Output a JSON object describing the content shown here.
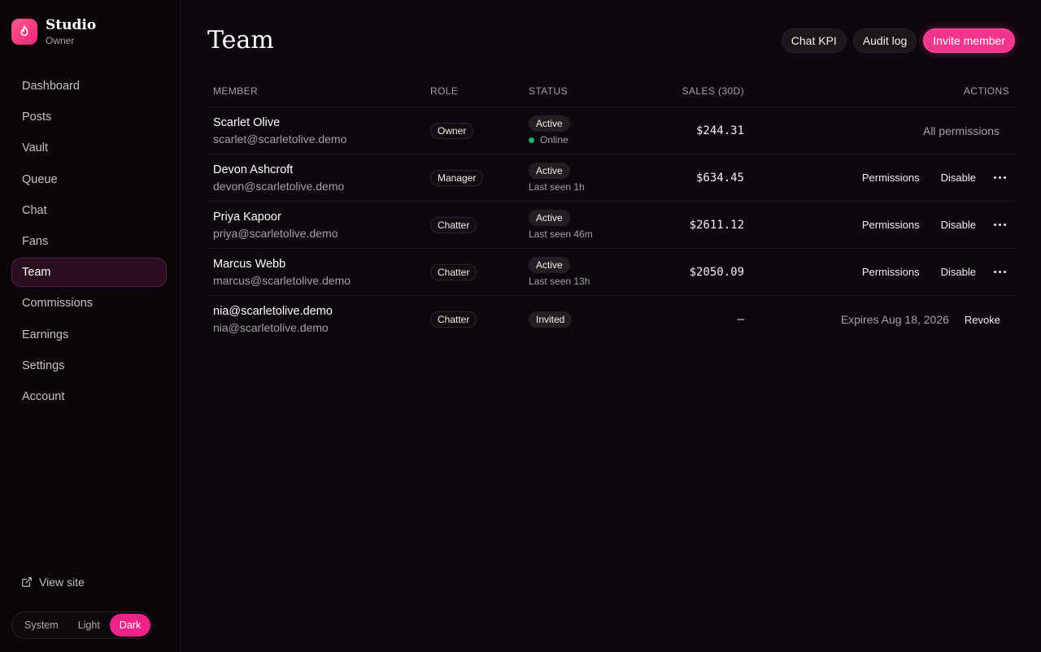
{
  "brand": {
    "name": "Studio",
    "role": "Owner"
  },
  "nav": {
    "items": [
      {
        "label": "Dashboard"
      },
      {
        "label": "Posts"
      },
      {
        "label": "Vault"
      },
      {
        "label": "Queue"
      },
      {
        "label": "Chat"
      },
      {
        "label": "Fans"
      },
      {
        "label": "Team",
        "active": true
      },
      {
        "label": "Commissions"
      },
      {
        "label": "Earnings"
      },
      {
        "label": "Settings"
      },
      {
        "label": "Account"
      }
    ],
    "view_site": "View site"
  },
  "theme": {
    "options": [
      "System",
      "Light",
      "Dark"
    ],
    "selected": "Dark"
  },
  "page": {
    "title": "Team",
    "actions": {
      "chat_kpi": "Chat KPI",
      "audit_log": "Audit log",
      "invite": "Invite member"
    }
  },
  "table": {
    "headers": {
      "member": "MEMBER",
      "role": "ROLE",
      "status": "STATUS",
      "sales": "SALES (30D)",
      "actions": "ACTIONS"
    },
    "rows": [
      {
        "name": "Scarlet Olive",
        "email": "scarlet@scarletolive.demo",
        "role": "Owner",
        "status": "Active",
        "status_sub": "Online",
        "online": true,
        "sales": "$244.31",
        "actions_text": "All permissions"
      },
      {
        "name": "Devon Ashcroft",
        "email": "devon@scarletolive.demo",
        "role": "Manager",
        "status": "Active",
        "status_sub": "Last seen 1h",
        "sales": "$634.45",
        "permissions": "Permissions",
        "disable": "Disable"
      },
      {
        "name": "Priya Kapoor",
        "email": "priya@scarletolive.demo",
        "role": "Chatter",
        "status": "Active",
        "status_sub": "Last seen 46m",
        "sales": "$2611.12",
        "permissions": "Permissions",
        "disable": "Disable"
      },
      {
        "name": "Marcus Webb",
        "email": "marcus@scarletolive.demo",
        "role": "Chatter",
        "status": "Active",
        "status_sub": "Last seen 13h",
        "sales": "$2050.09",
        "permissions": "Permissions",
        "disable": "Disable"
      },
      {
        "name": "nia@scarletolive.demo",
        "email": "nia@scarletolive.demo",
        "role": "Chatter",
        "status": "Invited",
        "sales": "–",
        "expires": "Expires Aug 18, 2026",
        "revoke": "Revoke"
      }
    ]
  },
  "icons": {
    "logo": "flame-icon",
    "view_site": "external-link-icon",
    "more": "more-horizontal-icon"
  },
  "colors": {
    "accent": "#f0368c",
    "online": "#18b26a",
    "background": "#0e070d"
  }
}
